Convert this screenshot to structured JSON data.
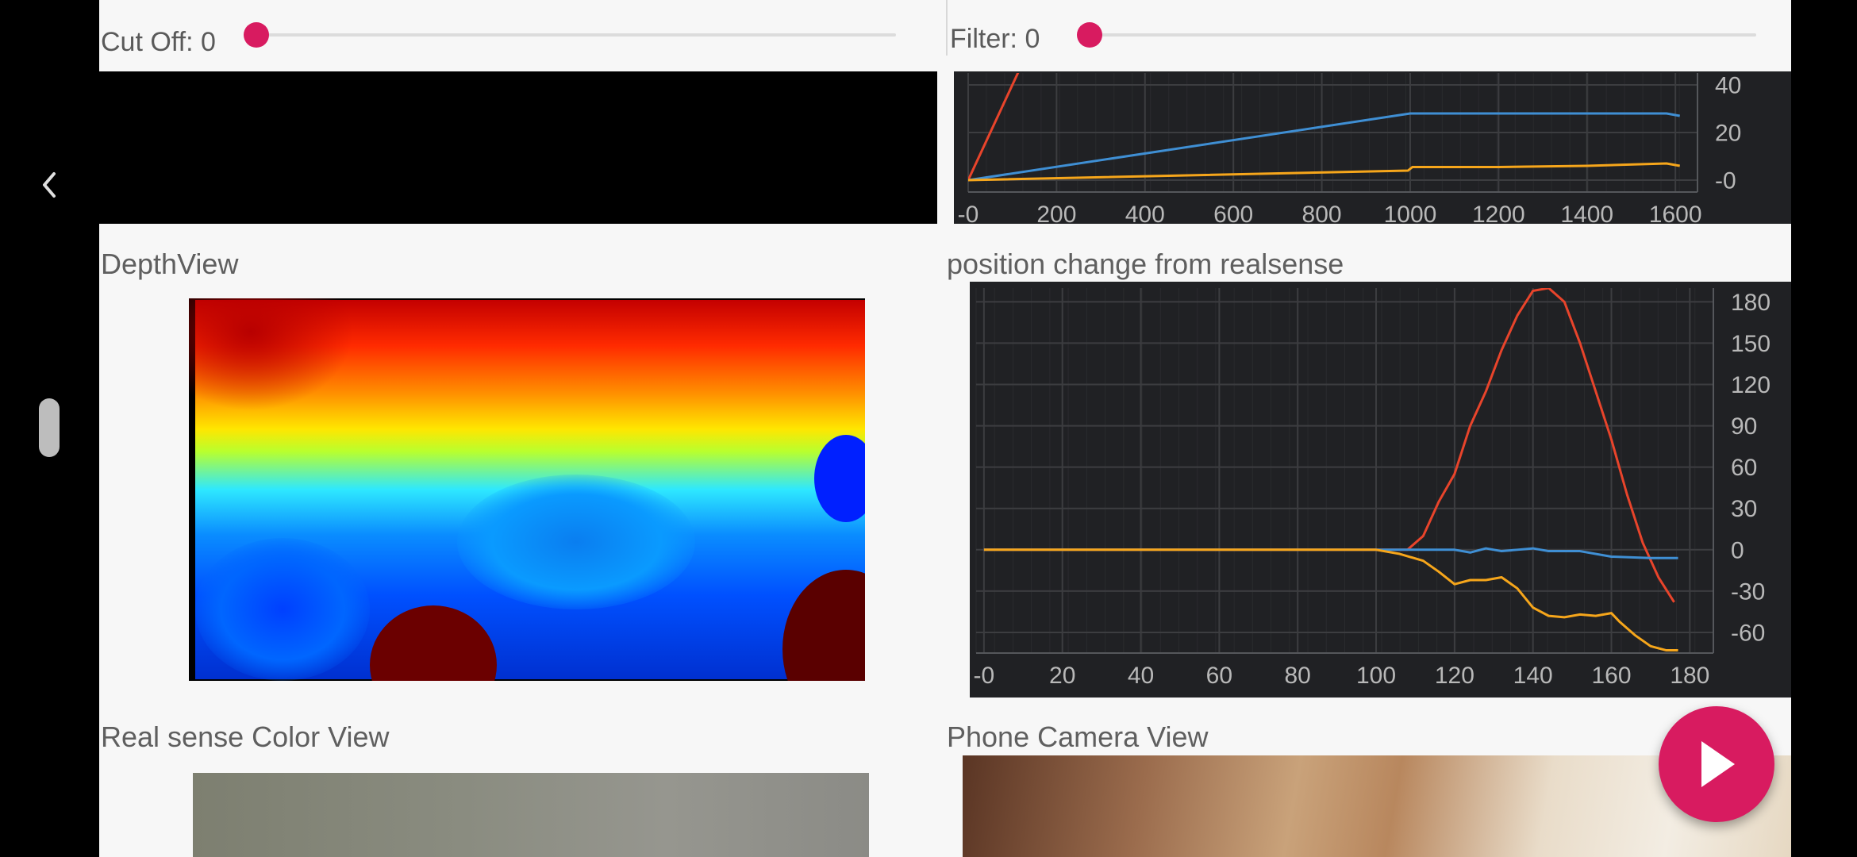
{
  "controls": {
    "cutoff": {
      "label": "Cut Off: 0",
      "value": 0
    },
    "filter": {
      "label": "Filter: 0",
      "value": 0
    }
  },
  "sections": {
    "depth_view": "DepthView",
    "position_change": "position change from realsense",
    "realsense_color": "Real sense Color View",
    "phone_camera": "Phone Camera View"
  },
  "icons": {
    "back": "chevron-left-icon",
    "fab": "play-icon"
  },
  "colors": {
    "accent": "#d81b60",
    "chart_bg": "#202124",
    "series_red": "#e8442b",
    "series_blue": "#3f8fd4",
    "series_orange": "#f6a61b"
  },
  "chart_data": [
    {
      "type": "line",
      "xlim": [
        0,
        1650
      ],
      "ylim": [
        -5,
        45
      ],
      "x_ticks": [
        "-0",
        "200",
        "400",
        "600",
        "800",
        "1000",
        "1200",
        "1400",
        "1600"
      ],
      "y_ticks": [
        "40",
        "20",
        "-0"
      ],
      "series": [
        {
          "color": "#e8442b",
          "points": [
            [
              0,
              0
            ],
            [
              150,
              60
            ]
          ]
        },
        {
          "color": "#3f8fd4",
          "points": [
            [
              0,
              0
            ],
            [
              1000,
              28
            ],
            [
              1200,
              28
            ],
            [
              1400,
              28
            ],
            [
              1580,
              28
            ],
            [
              1610,
              27
            ]
          ]
        },
        {
          "color": "#f6a61b",
          "points": [
            [
              0,
              0
            ],
            [
              995,
              4
            ],
            [
              1005,
              5.5
            ],
            [
              1200,
              5.5
            ],
            [
              1400,
              6
            ],
            [
              1580,
              7
            ],
            [
              1610,
              6
            ]
          ]
        }
      ]
    },
    {
      "type": "line",
      "xlim": [
        -2,
        186
      ],
      "ylim": [
        -75,
        190
      ],
      "x_ticks": [
        "-0",
        "20",
        "40",
        "60",
        "80",
        "100",
        "120",
        "140",
        "160",
        "180"
      ],
      "y_ticks": [
        "180",
        "150",
        "120",
        "90",
        "60",
        "30",
        "0",
        "-30",
        "-60"
      ],
      "series": [
        {
          "color": "#e8442b",
          "points": [
            [
              0,
              0
            ],
            [
              108,
              0
            ],
            [
              112,
              10
            ],
            [
              116,
              35
            ],
            [
              120,
              55
            ],
            [
              124,
              90
            ],
            [
              128,
              115
            ],
            [
              132,
              145
            ],
            [
              136,
              170
            ],
            [
              140,
              188
            ],
            [
              144,
              190
            ],
            [
              148,
              180
            ],
            [
              152,
              150
            ],
            [
              156,
              115
            ],
            [
              160,
              80
            ],
            [
              164,
              40
            ],
            [
              168,
              5
            ],
            [
              172,
              -20
            ],
            [
              176,
              -38
            ]
          ]
        },
        {
          "color": "#3f8fd4",
          "points": [
            [
              0,
              0
            ],
            [
              120,
              0
            ],
            [
              124,
              -2
            ],
            [
              128,
              1
            ],
            [
              132,
              -1
            ],
            [
              136,
              0
            ],
            [
              140,
              1
            ],
            [
              144,
              -1
            ],
            [
              152,
              -1
            ],
            [
              160,
              -5
            ],
            [
              170,
              -6
            ],
            [
              177,
              -6
            ]
          ]
        },
        {
          "color": "#f6a61b",
          "points": [
            [
              0,
              0
            ],
            [
              100,
              0
            ],
            [
              106,
              -3
            ],
            [
              112,
              -8
            ],
            [
              116,
              -16
            ],
            [
              120,
              -25
            ],
            [
              124,
              -22
            ],
            [
              128,
              -22
            ],
            [
              132,
              -20
            ],
            [
              136,
              -28
            ],
            [
              140,
              -42
            ],
            [
              144,
              -48
            ],
            [
              148,
              -49
            ],
            [
              152,
              -47
            ],
            [
              156,
              -48
            ],
            [
              160,
              -46
            ],
            [
              162,
              -52
            ],
            [
              166,
              -62
            ],
            [
              170,
              -70
            ],
            [
              174,
              -73
            ],
            [
              177,
              -73
            ]
          ]
        }
      ]
    }
  ]
}
